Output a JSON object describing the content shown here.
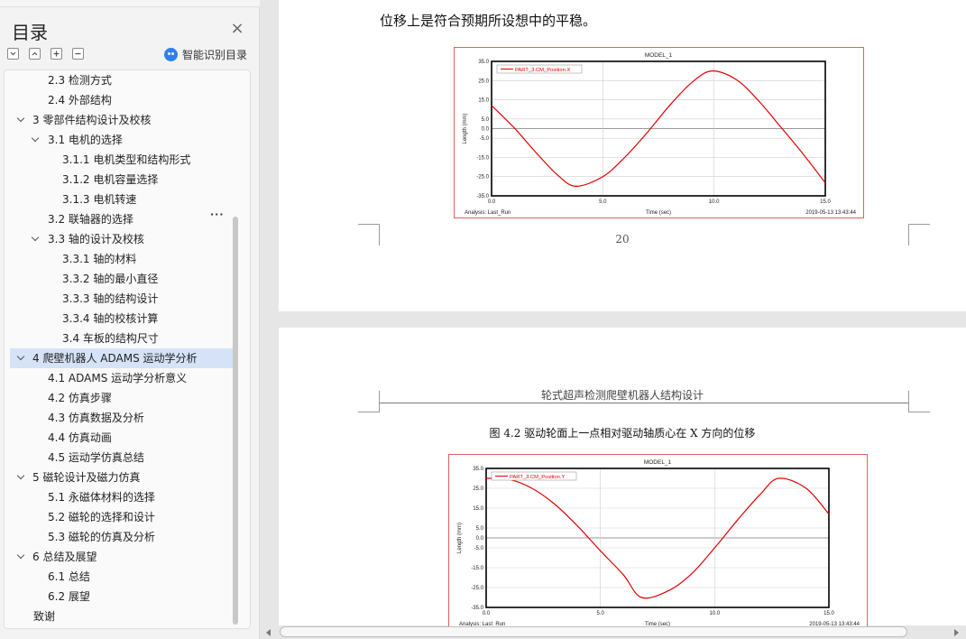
{
  "sidebar": {
    "title": "目录",
    "smart_toc_label": "智能识别目录",
    "toc": [
      {
        "text": "2.3 检测方式",
        "level": 2,
        "chevron": false,
        "active": false
      },
      {
        "text": "2.4 外部结构",
        "level": 2,
        "chevron": false,
        "active": false
      },
      {
        "text": "3 零部件结构设计及校核",
        "level": 1,
        "chevron": true,
        "active": false
      },
      {
        "text": "3.1 电机的选择",
        "level": 2,
        "chevron": true,
        "active": false
      },
      {
        "text": "3.1.1 电机类型和结构形式",
        "level": 3,
        "chevron": false,
        "active": false
      },
      {
        "text": "3.1.2 电机容量选择",
        "level": 3,
        "chevron": false,
        "active": false
      },
      {
        "text": "3.1.3 电机转速",
        "level": 3,
        "chevron": false,
        "active": false
      },
      {
        "text": "3.2 联轴器的选择",
        "level": 2,
        "chevron": false,
        "active": false
      },
      {
        "text": "3.3 轴的设计及校核",
        "level": 2,
        "chevron": true,
        "active": false
      },
      {
        "text": "3.3.1 轴的材料",
        "level": 3,
        "chevron": false,
        "active": false
      },
      {
        "text": "3.3.2 轴的最小直径",
        "level": 3,
        "chevron": false,
        "active": false
      },
      {
        "text": "3.3.3 轴的结构设计",
        "level": 3,
        "chevron": false,
        "active": false
      },
      {
        "text": "3.3.4 轴的校核计算",
        "level": 3,
        "chevron": false,
        "active": false
      },
      {
        "text": "3.4 车板的结构尺寸",
        "level": 3,
        "chevron": false,
        "active": false
      },
      {
        "text": "4  爬壁机器人 ADAMS 运动学分析",
        "level": 1,
        "chevron": true,
        "active": true
      },
      {
        "text": "4.1 ADAMS 运动学分析意义",
        "level": 2,
        "chevron": false,
        "active": false
      },
      {
        "text": "4.2 仿真步骤",
        "level": 2,
        "chevron": false,
        "active": false
      },
      {
        "text": "4.3 仿真数据及分析",
        "level": 2,
        "chevron": false,
        "active": false
      },
      {
        "text": "4.4 仿真动画",
        "level": 2,
        "chevron": false,
        "active": false
      },
      {
        "text": "4.5 运动学仿真总结",
        "level": 2,
        "chevron": false,
        "active": false
      },
      {
        "text": "5  磁轮设计及磁力仿真",
        "level": 1,
        "chevron": true,
        "active": false
      },
      {
        "text": "5.1 永磁体材料的选择",
        "level": 2,
        "chevron": false,
        "active": false
      },
      {
        "text": "5.2 磁轮的选择和设计",
        "level": 2,
        "chevron": false,
        "active": false
      },
      {
        "text": "5.3 磁轮的仿真及分析",
        "level": 2,
        "chevron": false,
        "active": false
      },
      {
        "text": "6  总结及展望",
        "level": 1,
        "chevron": true,
        "active": false
      },
      {
        "text": "6.1 总结",
        "level": 2,
        "chevron": false,
        "active": false
      },
      {
        "text": "6.2 展望",
        "level": 2,
        "chevron": false,
        "active": false
      },
      {
        "text": "致谢",
        "level": 0,
        "chevron": false,
        "active": false
      }
    ]
  },
  "document": {
    "page1_body_line": "位移上是符合预期所设想中的平稳。",
    "page1_number": "20",
    "page2_header": "轮式超声检测爬壁机器人结构设计",
    "page2_caption": "图 4.2  驱动轮面上一点相对驱动轴质心在 X 方向的位移"
  },
  "chart_data": [
    {
      "type": "line",
      "title": "MODEL_1",
      "xlabel": "Time (sec)",
      "ylabel": "Length (mm)",
      "xlim": [
        0.0,
        15.0
      ],
      "ylim": [
        -35.0,
        35.0
      ],
      "x_ticks": [
        "0.0",
        "5.0",
        "10.0",
        "15.0"
      ],
      "y_ticks": [
        "35.0",
        "25.0",
        "15.0",
        "5.0",
        "0.0",
        "-5.0",
        "-15.0",
        "-25.0",
        "-35.0"
      ],
      "grid": true,
      "legend_position": "top-left",
      "footer_left": "Analysis:  Last_Run",
      "footer_right": "2019-05-13 13:43:44",
      "series": [
        {
          "name": "PART_3.CM_Position.X",
          "color": "#e00000",
          "x": [
            0,
            1,
            2,
            3,
            3.8,
            5,
            6,
            7,
            8,
            9,
            9.9,
            11,
            12,
            13,
            14,
            15
          ],
          "y": [
            12.0,
            0.6,
            -12.5,
            -24.5,
            -30.0,
            -25.0,
            -14.8,
            -2.0,
            12.0,
            24.0,
            30.0,
            25.5,
            14.5,
            0.8,
            -13.2,
            -28.2
          ]
        }
      ]
    },
    {
      "type": "line",
      "title": "MODEL_1",
      "xlabel": "Time (sec)",
      "ylabel": "Length (mm)",
      "xlim": [
        0.0,
        15.0
      ],
      "ylim": [
        -35.0,
        35.0
      ],
      "x_ticks": [
        "0.0",
        "5.0",
        "10.0",
        "15.0"
      ],
      "y_ticks": [
        "35.0",
        "25.0",
        "15.0",
        "5.0",
        "0.0",
        "-5.0",
        "-15.0",
        "-25.0",
        "-35.0"
      ],
      "grid": true,
      "legend_position": "top-left",
      "footer_left": "Analysis:  Last_Run",
      "footer_right": "2019-05-13 13:43:44",
      "series": [
        {
          "name": "PART_3.CM_Position.Y",
          "color": "#e00000",
          "x": [
            0,
            1,
            2,
            3,
            4,
            5,
            6,
            6.8,
            8,
            9,
            10,
            11,
            12,
            12.8,
            14,
            15
          ],
          "y": [
            30.0,
            29.5,
            25.0,
            17.0,
            6.0,
            -6.5,
            -18.5,
            -30.0,
            -26.5,
            -18.0,
            -5.0,
            9.0,
            22.0,
            30.0,
            25.0,
            12.0
          ]
        }
      ]
    }
  ]
}
